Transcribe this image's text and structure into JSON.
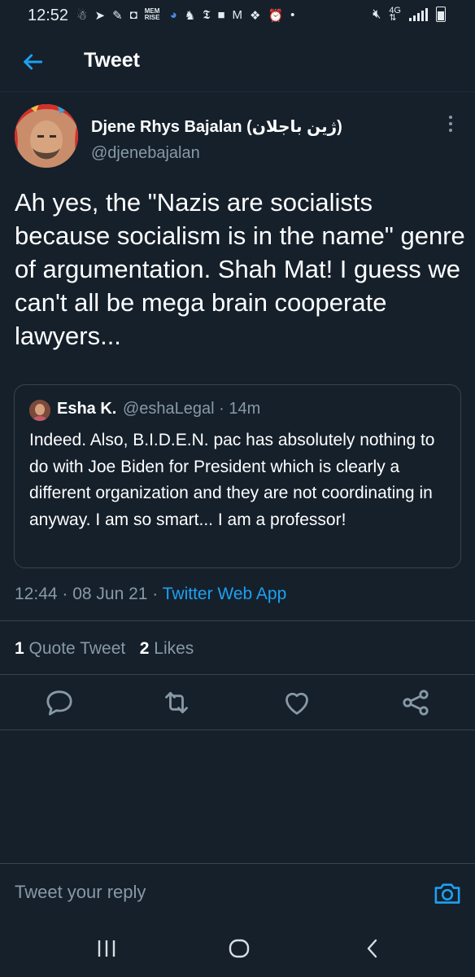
{
  "status_bar": {
    "time": "12:52",
    "icons": [
      "app-icons"
    ],
    "mem_rise": "MEM RISE"
  },
  "header": {
    "title": "Tweet"
  },
  "tweet": {
    "author_name": "Djene Rhys Bajalan (ژین باجلان)",
    "author_handle": "@djenebajalan",
    "text": "Ah yes, the \"Nazis are socialists because socialism is in the name\" genre of argumentation. Shah Mat! I guess we can't all be mega brain cooperate lawyers...",
    "timestamp": "12:44 · 08 Jun 21 · ",
    "source_app": "Twitter Web App",
    "quote_tweet_count": "1",
    "quote_tweet_label": "Quote Tweet",
    "likes_count": "2",
    "likes_label": "Likes"
  },
  "quoted_tweet": {
    "author_name": "Esha K.",
    "meta": "@eshaLegal · 14m",
    "text": "Indeed. Also, B.I.D.E.N. pac has absolutely nothing to do with Joe Biden for President which is clearly a different organization and they are not coordinating in anyway.  I am so smart... I am a professor!"
  },
  "reply": {
    "placeholder": "Tweet your reply"
  },
  "colors": {
    "background": "#15202b",
    "accent": "#1da1f2",
    "muted": "#8899a6",
    "border": "#38444d"
  }
}
